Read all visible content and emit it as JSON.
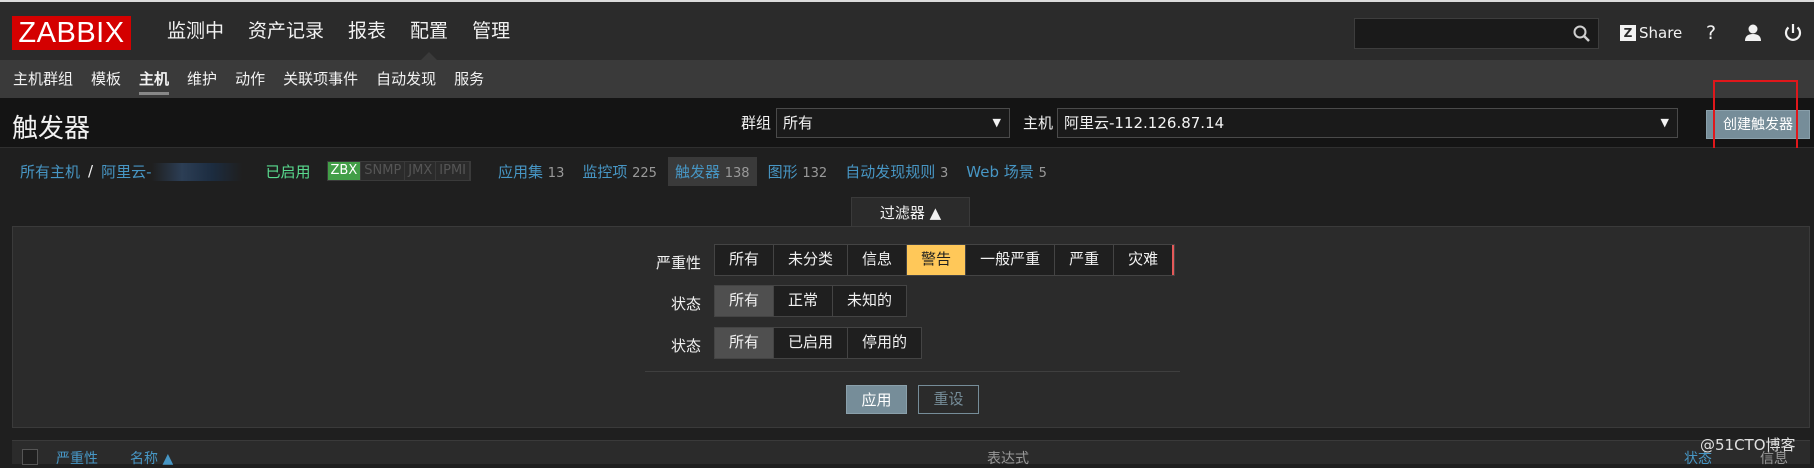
{
  "topbar": {
    "logo": "ZABBIX",
    "menu": [
      "监测中",
      "资产记录",
      "报表",
      "配置",
      "管理"
    ],
    "active_menu": "配置",
    "search": {
      "value": "",
      "placeholder": ""
    },
    "share_label": "Share",
    "share_badge": "Z",
    "help_label": "?",
    "icons": [
      "search-icon",
      "help-icon",
      "user-icon",
      "power-icon"
    ]
  },
  "submenu": {
    "items": [
      "主机群组",
      "模板",
      "主机",
      "维护",
      "动作",
      "关联项事件",
      "自动发现",
      "服务"
    ],
    "active": "主机"
  },
  "header": {
    "title": "触发器",
    "group_label": "群组",
    "group_value": "所有",
    "host_label": "主机",
    "host_value": "阿里云-112.126.87.14",
    "create_button": "创建触发器"
  },
  "breadcrumbs": {
    "all_hosts": "所有主机",
    "separator": "/",
    "host": "阿里云-",
    "status": "已启用",
    "availability": [
      "ZBX",
      "SNMP",
      "JMX",
      "IPMI"
    ],
    "tabs": [
      {
        "label": "应用集",
        "count": "13"
      },
      {
        "label": "监控项",
        "count": "225"
      },
      {
        "label": "触发器",
        "count": "138"
      },
      {
        "label": "图形",
        "count": "132"
      },
      {
        "label": "自动发现规则",
        "count": "3"
      },
      {
        "label": "Web 场景",
        "count": "5"
      }
    ]
  },
  "filter": {
    "tab_label": "过滤器 ▲",
    "severity_label": "严重性",
    "severity_options": [
      "所有",
      "未分类",
      "信息",
      "警告",
      "一般严重",
      "严重",
      "灾难"
    ],
    "severity_selected": "警告",
    "state_label": "状态",
    "state_options": [
      "所有",
      "正常",
      "未知的"
    ],
    "state_selected": "所有",
    "status_label": "状态",
    "status_options": [
      "所有",
      "已启用",
      "停用的"
    ],
    "status_selected": "所有",
    "apply": "应用",
    "reset": "重设"
  },
  "table": {
    "columns": [
      "严重性",
      "名称 ▲",
      "表达式",
      "状态",
      "信息"
    ]
  },
  "watermark": "@51CTO博客",
  "colors": {
    "brand_red": "#d40000",
    "link_blue": "#4796c4",
    "enabled_green": "#59db8f",
    "zbx_green": "#429e47",
    "warning_yellow": "#ffc859",
    "button_gray_blue": "#768d99",
    "annotation_red": "#e0171b"
  }
}
